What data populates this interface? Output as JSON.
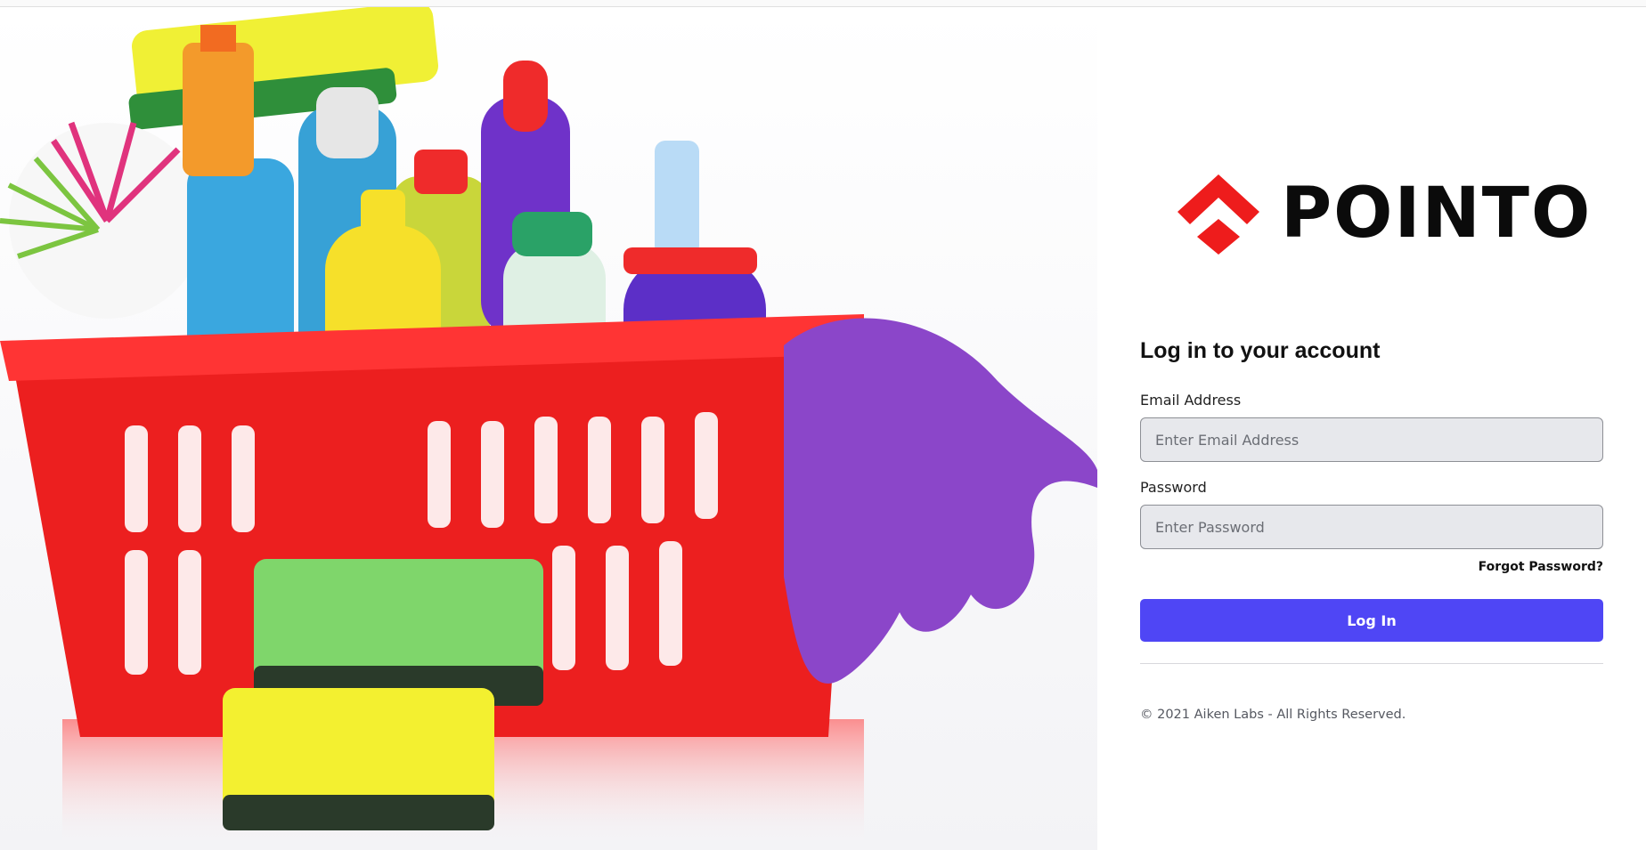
{
  "hero": {
    "image_description_icon": "cleaning-basket-illustration"
  },
  "brand": {
    "name": "POINTO",
    "mark_icon": "pointo-logo-mark-icon",
    "mark_color": "#ee1c1c"
  },
  "form": {
    "heading": "Log in to your account",
    "email_label": "Email Address",
    "email_placeholder": "Enter Email Address",
    "email_value": "",
    "password_label": "Password",
    "password_placeholder": "Enter Password",
    "password_value": "",
    "forgot_label": "Forgot Password?",
    "submit_label": "Log In",
    "submit_color": "#4f46f5"
  },
  "footer": {
    "copyright": "© 2021 Aiken Labs - All Rights Reserved."
  }
}
